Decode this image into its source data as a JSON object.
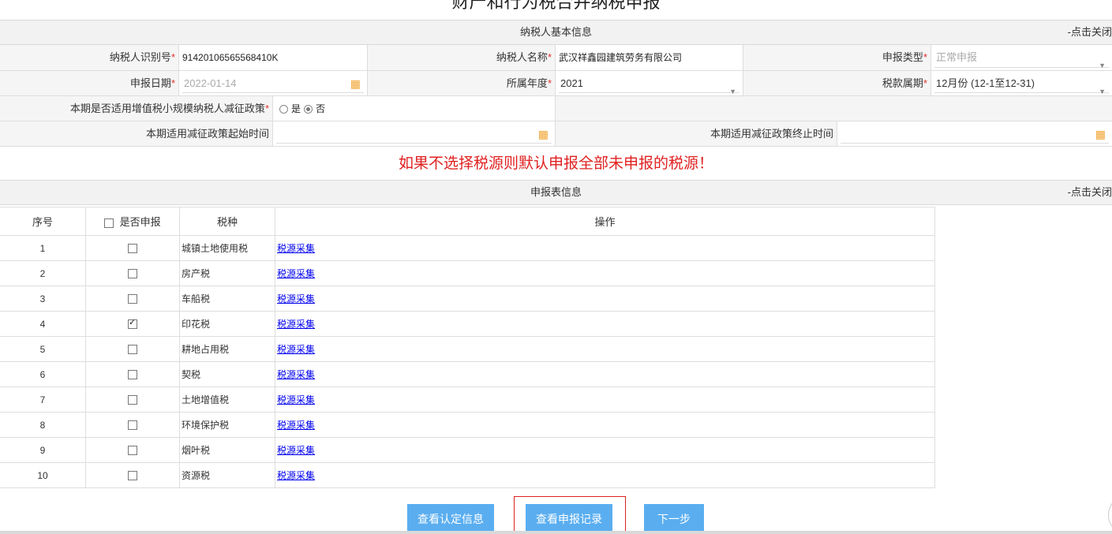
{
  "title": "财产和行为税合并纳税申报",
  "basic_section": {
    "title": "纳税人基本信息",
    "toggle": "-点击关闭"
  },
  "basic": {
    "taxpayer_id_label": "纳税人识别号",
    "taxpayer_id": "91420106565568410K",
    "taxpayer_name_label": "纳税人名称",
    "taxpayer_name": "武汉祥鑫园建筑劳务有限公司",
    "filing_type_label": "申报类型",
    "filing_type": "正常申报",
    "filing_date_label": "申报日期",
    "filing_date": "2022-01-14",
    "year_label": "所属年度",
    "year": "2021",
    "period_label": "税款属期",
    "period": "12月份 (12-1至12-31)",
    "policy_label": "本期是否适用增值税小规模纳税人减征政策",
    "policy_yes": "是",
    "policy_no": "否",
    "policy_selected": "否",
    "start_label": "本期适用减征政策起始时间",
    "end_label": "本期适用减征政策终止时间",
    "required_mark": "*"
  },
  "warning": "如果不选择税源则默认申报全部未申报的税源！",
  "report_section": {
    "title": "申报表信息",
    "toggle": "-点击关闭"
  },
  "table": {
    "headers": {
      "num": "序号",
      "declare": "是否申报",
      "tax": "税种",
      "op": "操作"
    },
    "rows": [
      {
        "num": "1",
        "checked": false,
        "tax": "城镇土地使用税",
        "op": "税源采集"
      },
      {
        "num": "2",
        "checked": false,
        "tax": "房产税",
        "op": "税源采集"
      },
      {
        "num": "3",
        "checked": false,
        "tax": "车船税",
        "op": "税源采集"
      },
      {
        "num": "4",
        "checked": true,
        "tax": "印花税",
        "op": "税源采集"
      },
      {
        "num": "5",
        "checked": false,
        "tax": "耕地占用税",
        "op": "税源采集"
      },
      {
        "num": "6",
        "checked": false,
        "tax": "契税",
        "op": "税源采集"
      },
      {
        "num": "7",
        "checked": false,
        "tax": "土地增值税",
        "op": "税源采集"
      },
      {
        "num": "8",
        "checked": false,
        "tax": "环境保护税",
        "op": "税源采集"
      },
      {
        "num": "9",
        "checked": false,
        "tax": "烟叶税",
        "op": "税源采集"
      },
      {
        "num": "10",
        "checked": false,
        "tax": "资源税",
        "op": "税源采集"
      }
    ]
  },
  "buttons": {
    "view_cert": "查看认定信息",
    "view_records": "查看申报记录",
    "next": "下一步"
  },
  "colors": {
    "accent": "#5aaef0",
    "warning": "#e02020",
    "required": "#e23030",
    "link": "#0000ee"
  }
}
